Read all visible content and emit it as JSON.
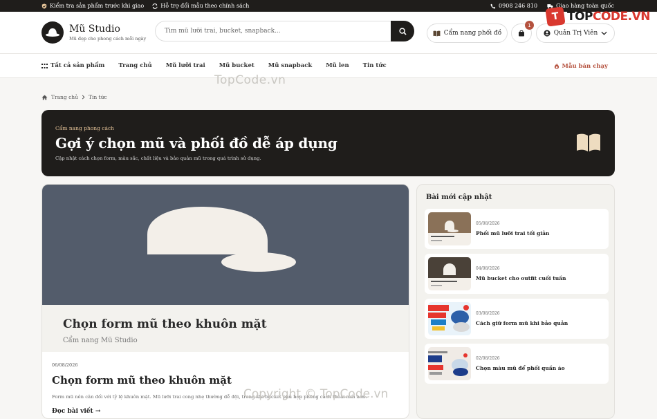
{
  "topbar": {
    "left_1": "Kiểm tra sản phẩm trước khi giao",
    "left_2": "Hỗ trợ đổi mẫu theo chính sách",
    "phone": "0908 246 810",
    "shipping": "Giao hàng toàn quốc"
  },
  "watermark": {
    "logo_badge": "T",
    "logo_text_1": "TOP",
    "logo_text_2": "CODE.VN",
    "center": "TopCode.vn",
    "bottom": "Copyright © TopCode.vn"
  },
  "header": {
    "brand_name": "Mũ Studio",
    "brand_tagline": "Mũ đẹp cho phong cách mỗi ngày",
    "search_placeholder": "Tìm mũ lưỡi trai, bucket, snapback...",
    "guide_label": "Cẩm nang phối đồ",
    "cart_count": "1",
    "user_label": "Quản Trị Viên"
  },
  "nav": {
    "all_products": "Tất cả sản phẩm",
    "items": [
      "Trang chủ",
      "Mũ lưỡi trai",
      "Mũ bucket",
      "Mũ snapback",
      "Mũ len",
      "Tin tức"
    ],
    "best_seller": "Mẫu bán chạy"
  },
  "breadcrumb": {
    "home": "Trang chủ",
    "current": "Tin tức"
  },
  "hero": {
    "kicker": "Cẩm nang phong cách",
    "title": "Gợi ý chọn mũ và phối đồ dễ áp dụng",
    "description": "Cập nhật cách chọn form, màu sắc, chất liệu và bảo quản mũ trong quá trình sử dụng."
  },
  "featured": {
    "image_title": "Chọn form mũ theo khuôn mặt",
    "image_subtitle": "Cẩm nang Mũ Studio",
    "date": "06/08/2026",
    "title": "Chọn form mũ theo khuôn mặt",
    "excerpt": "Form mũ nên cân đối với tỷ lệ khuôn mặt. Mũ lưỡi trai cong nhẹ thường dễ đội, trong khi bucket phù hợp phong cách thoải mái hơn.",
    "read_more": "Đọc bài viết →"
  },
  "sidebar": {
    "heading": "Bài mới cập nhật",
    "posts": [
      {
        "date": "05/08/2026",
        "title": "Phối mũ lưỡi trai tối giản"
      },
      {
        "date": "04/08/2026",
        "title": "Mũ bucket cho outfit cuối tuần"
      },
      {
        "date": "03/08/2026",
        "title": "Cách giữ form mũ khi bảo quản"
      },
      {
        "date": "02/08/2026",
        "title": "Chọn màu mũ để phối quần áo"
      }
    ]
  },
  "colors": {
    "dark": "#1f1d1b",
    "accent": "#b5523f",
    "kicker": "#e7c59a",
    "thumb_bg": "#535c6b"
  }
}
